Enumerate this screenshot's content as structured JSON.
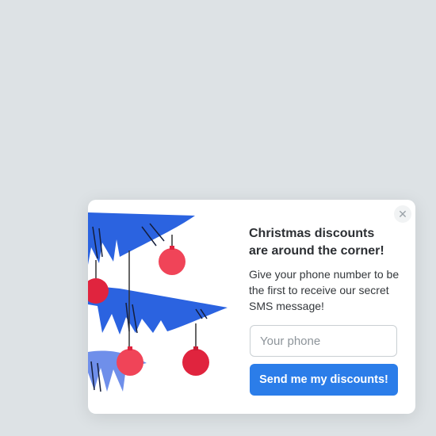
{
  "popup": {
    "close_icon": "close-icon",
    "close_glyph": "✕",
    "title_line1": "Christmas discounts",
    "title_line2": "are around the corner!",
    "description": "Give your phone number to be the first to receive our secret SMS message!",
    "phone_placeholder": "Your phone",
    "phone_value": "",
    "submit_label": "Send me my discounts!",
    "illustration": "christmas-tree-branches-with-ornaments",
    "colors": {
      "background": "#dde2e5",
      "card": "#ffffff",
      "accent": "#2b7de9",
      "branch": "#2b63e0",
      "branch_light": "#6f8fea",
      "ornament": "#f04458",
      "ornament_dark": "#e0243e"
    }
  }
}
